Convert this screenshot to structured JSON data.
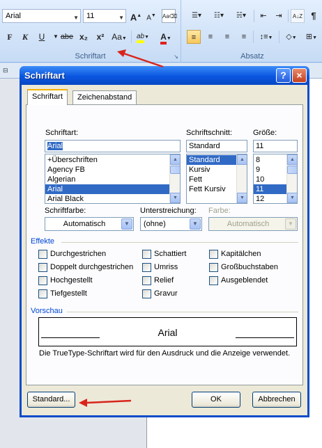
{
  "ribbon": {
    "font_name": "Arial",
    "font_size": "11",
    "group_font_label": "Schriftart",
    "group_paragraph_label": "Absatz",
    "bold": "F",
    "italic": "K",
    "underline": "U",
    "strike": "abe",
    "subscript": "x₂",
    "superscript": "x²",
    "case": "Aa",
    "grow_font": "A",
    "shrink_font": "A",
    "highlight": "ab",
    "font_color": "A",
    "sort": "A↓Z",
    "ruler_number": "4"
  },
  "dialog": {
    "title": "Schriftart",
    "help": "?",
    "close": "×",
    "tabs": [
      "Schriftart",
      "Zeichenabstand"
    ],
    "font_label": "Schriftart:",
    "font_value": "Arial",
    "font_list": [
      "+Überschriften",
      "Agency FB",
      "Algerian",
      "Arial",
      "Arial Black"
    ],
    "font_selected_index": 3,
    "style_label": "Schriftschnitt:",
    "style_value": "Standard",
    "style_list": [
      "Standard",
      "Kursiv",
      "Fett",
      "Fett Kursiv"
    ],
    "style_selected_index": 0,
    "size_label": "Größe:",
    "size_value": "11",
    "size_list": [
      "8",
      "9",
      "10",
      "11",
      "12"
    ],
    "size_selected_index": 3,
    "font_color_label": "Schriftfarbe:",
    "font_color_value": "Automatisch",
    "underline_label": "Unterstreichung:",
    "underline_value": "(ohne)",
    "underline_color_label": "Farbe:",
    "underline_color_value": "Automatisch",
    "effects_label": "Effekte",
    "effects": [
      [
        "Durchgestrichen",
        "Schattiert",
        "Kapitälchen"
      ],
      [
        "Doppelt durchgestrichen",
        "Umriss",
        "Großbuchstaben"
      ],
      [
        "Hochgestellt",
        "Relief",
        "Ausgeblendet"
      ],
      [
        "Tiefgestellt",
        "Gravur",
        ""
      ]
    ],
    "preview_label": "Vorschau",
    "preview_text": "Arial",
    "preview_note": "Die TrueType-Schriftart wird für den Ausdruck und die Anzeige verwendet.",
    "default_button": "Standard...",
    "ok_button": "OK",
    "cancel_button": "Abbrechen"
  },
  "colors": {
    "accent_selection": "#316ac5",
    "arrow": "#d9241c",
    "titlebar": "#0a55e0"
  }
}
